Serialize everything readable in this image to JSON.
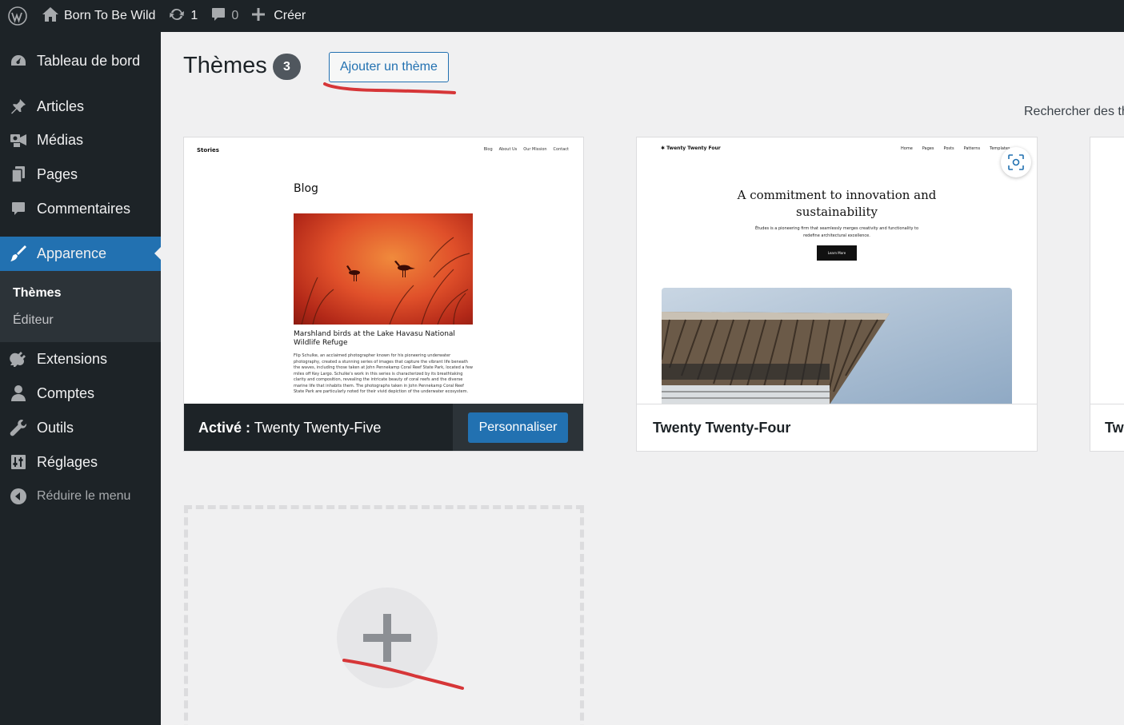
{
  "adminbar": {
    "site_name": "Born To Be Wild",
    "updates_count": "1",
    "comments_count": "0",
    "new_label": "Créer"
  },
  "menu": {
    "dashboard": "Tableau de bord",
    "posts": "Articles",
    "media": "Médias",
    "pages": "Pages",
    "comments": "Commentaires",
    "appearance": "Apparence",
    "sub_themes": "Thèmes",
    "sub_editor": "Éditeur",
    "plugins": "Extensions",
    "users": "Comptes",
    "tools": "Outils",
    "settings": "Réglages",
    "collapse": "Réduire le menu"
  },
  "page": {
    "title": "Thèmes",
    "count": "3",
    "add_theme": "Ajouter un thème",
    "search_label": "Rechercher des th"
  },
  "themes": {
    "active_prefix": "Activé :",
    "active_name": "Twenty Twenty-Five",
    "customize": "Personnaliser",
    "second_name": "Twenty Twenty-Four",
    "third_name": "Tw"
  },
  "preview1": {
    "brand": "Stories",
    "nav": [
      "Blog",
      "About Us",
      "Our Mission",
      "Contact"
    ],
    "heading": "Blog",
    "caption": "Marshland birds at the Lake Havasu National Wildlife Refuge",
    "paragraph": "Flip Schulke, an acclaimed photographer known for his pioneering underwater photography, created a stunning series of images that capture the vibrant life beneath the waves, including those taken at John Pennekamp Coral Reef State Park, located a few miles off Key Largo. Schulke's work in this series is characterized by its breathtaking clarity and composition, revealing the intricate beauty of coral reefs and the diverse marine life that inhabits them. The photographs taken in John Pennekamp Coral Reef State Park are particularly noted for their vivid depiction of the underwater ecosystem."
  },
  "preview2": {
    "brand": "Twenty Twenty Four",
    "nav": [
      "Home",
      "Pages",
      "Posts",
      "Patterns",
      "Templates"
    ],
    "headline": "A commitment to innovation and sustainability",
    "sub": "Études is a pioneering firm that seamlessly merges creativity and functionality to redefine architectural excellence.",
    "button": "Learn More"
  },
  "colors": {
    "accent": "#2271b1",
    "sidebar": "#1d2327",
    "annotation": "#d63638"
  }
}
